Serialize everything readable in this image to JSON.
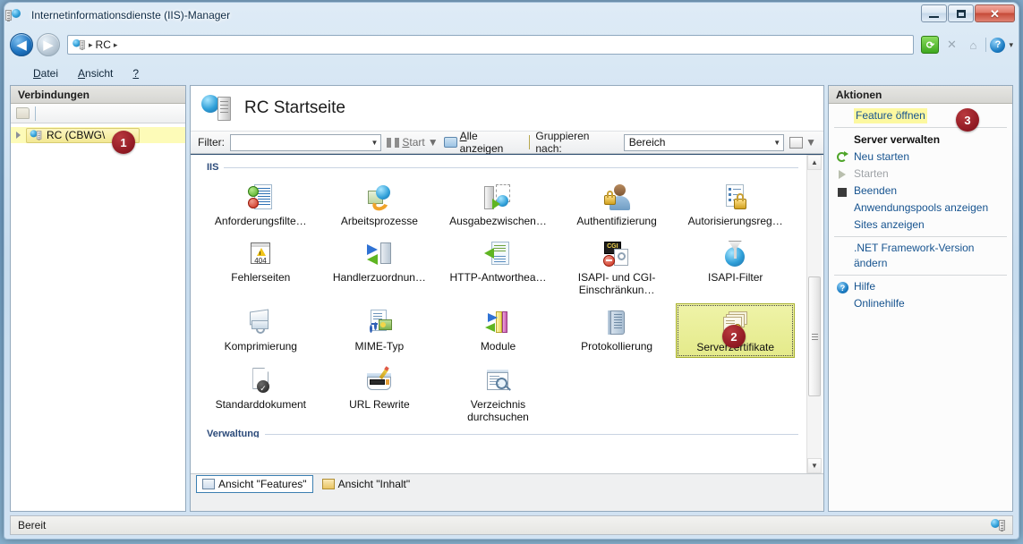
{
  "window": {
    "title": "Internetinformationsdienste (IIS)-Manager",
    "title_icon": "iis-server-icon",
    "minimize_label": "Minimieren",
    "maximize_label": "Maximieren",
    "close_label": "Schließen"
  },
  "addressbar": {
    "back_label": "Zurück",
    "forward_label": "Vorwärts",
    "icon": "iis-server-icon",
    "crumbs": [
      "RC"
    ],
    "separator": "▸",
    "refresh_label": "Aktualisieren",
    "stop_label": "Abbrechen",
    "home_label": "Startseite",
    "help_label": "?"
  },
  "menubar": {
    "items": [
      {
        "label": "Datei",
        "accel": "D"
      },
      {
        "label": "Ansicht",
        "accel": "A"
      },
      {
        "label": "?",
        "accel": ""
      }
    ]
  },
  "connections": {
    "header": "Verbindungen",
    "toolbar_icon": "connect-folder-icon",
    "tree": [
      {
        "label": "RC (CBWG\\",
        "selected": true,
        "expander": "collapsed-arrow-icon",
        "icon": "iis-server-icon"
      }
    ]
  },
  "center": {
    "page_title": "RC Startseite",
    "page_icon": "iis-server-icon",
    "filter": {
      "label": "Filter:",
      "value": "",
      "placeholder": "",
      "go_label": "Start",
      "go_accel": "S",
      "show_all_label": "Alle anzeigen",
      "show_all_accel": "A",
      "group_by_label": "Gruppieren nach:",
      "group_by_value": "Bereich",
      "view_mode_label": "Ansicht ändern"
    },
    "groups": [
      {
        "name": "IIS",
        "items": [
          {
            "label": "Anforderungsfilte…",
            "icon": "request-filtering-icon",
            "selected": false
          },
          {
            "label": "Arbeitsprozesse",
            "icon": "worker-processes-icon",
            "selected": false
          },
          {
            "label": "Ausgabezwischen…",
            "icon": "output-caching-icon",
            "selected": false
          },
          {
            "label": "Authentifizierung",
            "icon": "authentication-icon",
            "selected": false
          },
          {
            "label": "Autorisierungsreg…",
            "icon": "authorization-rules-icon",
            "selected": false
          },
          {
            "label": "Fehlerseiten",
            "icon": "error-pages-icon",
            "selected": false
          },
          {
            "label": "Handlerzuordnun…",
            "icon": "handler-mappings-icon",
            "selected": false
          },
          {
            "label": "HTTP-Antworthea…",
            "icon": "http-response-headers-icon",
            "selected": false
          },
          {
            "label": "ISAPI- und CGI-Einschränkun…",
            "icon": "isapi-cgi-restrictions-icon",
            "selected": false
          },
          {
            "label": "ISAPI-Filter",
            "icon": "isapi-filters-icon",
            "selected": false
          },
          {
            "label": "Komprimierung",
            "icon": "compression-icon",
            "selected": false
          },
          {
            "label": "MIME-Typ",
            "icon": "mime-types-icon",
            "selected": false
          },
          {
            "label": "Module",
            "icon": "modules-icon",
            "selected": false
          },
          {
            "label": "Protokollierung",
            "icon": "logging-icon",
            "selected": false
          },
          {
            "label": "Serverzertifikate",
            "icon": "server-certificates-icon",
            "selected": true
          },
          {
            "label": "Standarddokument",
            "icon": "default-document-icon",
            "selected": false
          },
          {
            "label": "URL Rewrite",
            "icon": "url-rewrite-icon",
            "selected": false
          },
          {
            "label": "Verzeichnis durchsuchen",
            "icon": "directory-browsing-icon",
            "selected": false
          }
        ]
      },
      {
        "name": "Verwaltung",
        "items": []
      }
    ],
    "view_tabs": [
      {
        "label": "Ansicht \"Features\"",
        "icon": "features-view-icon",
        "active": true
      },
      {
        "label": "Ansicht \"Inhalt\"",
        "icon": "content-view-icon",
        "active": false
      }
    ]
  },
  "actions": {
    "header": "Aktionen",
    "groups": [
      {
        "items": [
          {
            "label": "Feature öffnen",
            "style": "highlight",
            "icon": ""
          }
        ]
      },
      {
        "items": [
          {
            "label": "Server verwalten",
            "style": "bold",
            "icon": ""
          },
          {
            "label": "Neu starten",
            "style": "link",
            "icon": "restart-icon"
          },
          {
            "label": "Starten",
            "style": "disabled",
            "icon": "start-triangle-icon"
          },
          {
            "label": "Beenden",
            "style": "link",
            "icon": "stop-square-icon"
          },
          {
            "label": "Anwendungspools anzeigen",
            "style": "link",
            "icon": ""
          },
          {
            "label": "Sites anzeigen",
            "style": "link",
            "icon": ""
          }
        ]
      },
      {
        "items": [
          {
            "label": ".NET Framework-Version ändern",
            "style": "link",
            "icon": ""
          }
        ]
      },
      {
        "items": [
          {
            "label": "Hilfe",
            "style": "link",
            "icon": "help-icon"
          },
          {
            "label": "Onlinehilfe",
            "style": "link",
            "icon": ""
          }
        ]
      }
    ]
  },
  "statusbar": {
    "text": "Bereit",
    "icon": "iis-server-icon"
  },
  "badges": [
    {
      "number": "1",
      "target": "connections-tree-node"
    },
    {
      "number": "2",
      "target": "server-certificates-cell"
    },
    {
      "number": "3",
      "target": "open-feature-action"
    }
  ],
  "colors": {
    "accent_link": "#16538f",
    "highlight_yellow": "#fcf8a0",
    "selection_green": "#e4ea8a",
    "badge_red": "#951d26",
    "group_header": "#2b4a7a"
  }
}
